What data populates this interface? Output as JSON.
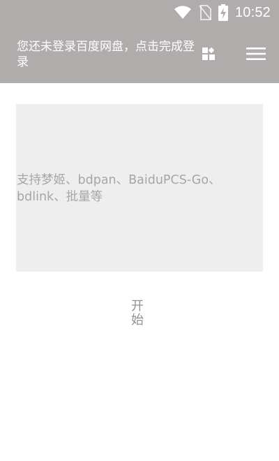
{
  "status_bar": {
    "time": "10:52",
    "icons": [
      "wifi-icon",
      "no-sim-icon",
      "battery-charging-icon"
    ]
  },
  "app_bar": {
    "title": "您还未登录百度网盘，点击完成登录",
    "actions": [
      "qr-code-icon",
      "menu-icon"
    ]
  },
  "main": {
    "link_input_placeholder": "支持梦姬、bdpan、BaiduPCS-Go、bdlink、批量等",
    "start_button_label": "开始"
  },
  "colors": {
    "app_bar_bg": "#b1acac",
    "input_bg": "#eeeeee",
    "placeholder_text": "#a6a6a6",
    "button_text": "#8f8f8f"
  }
}
